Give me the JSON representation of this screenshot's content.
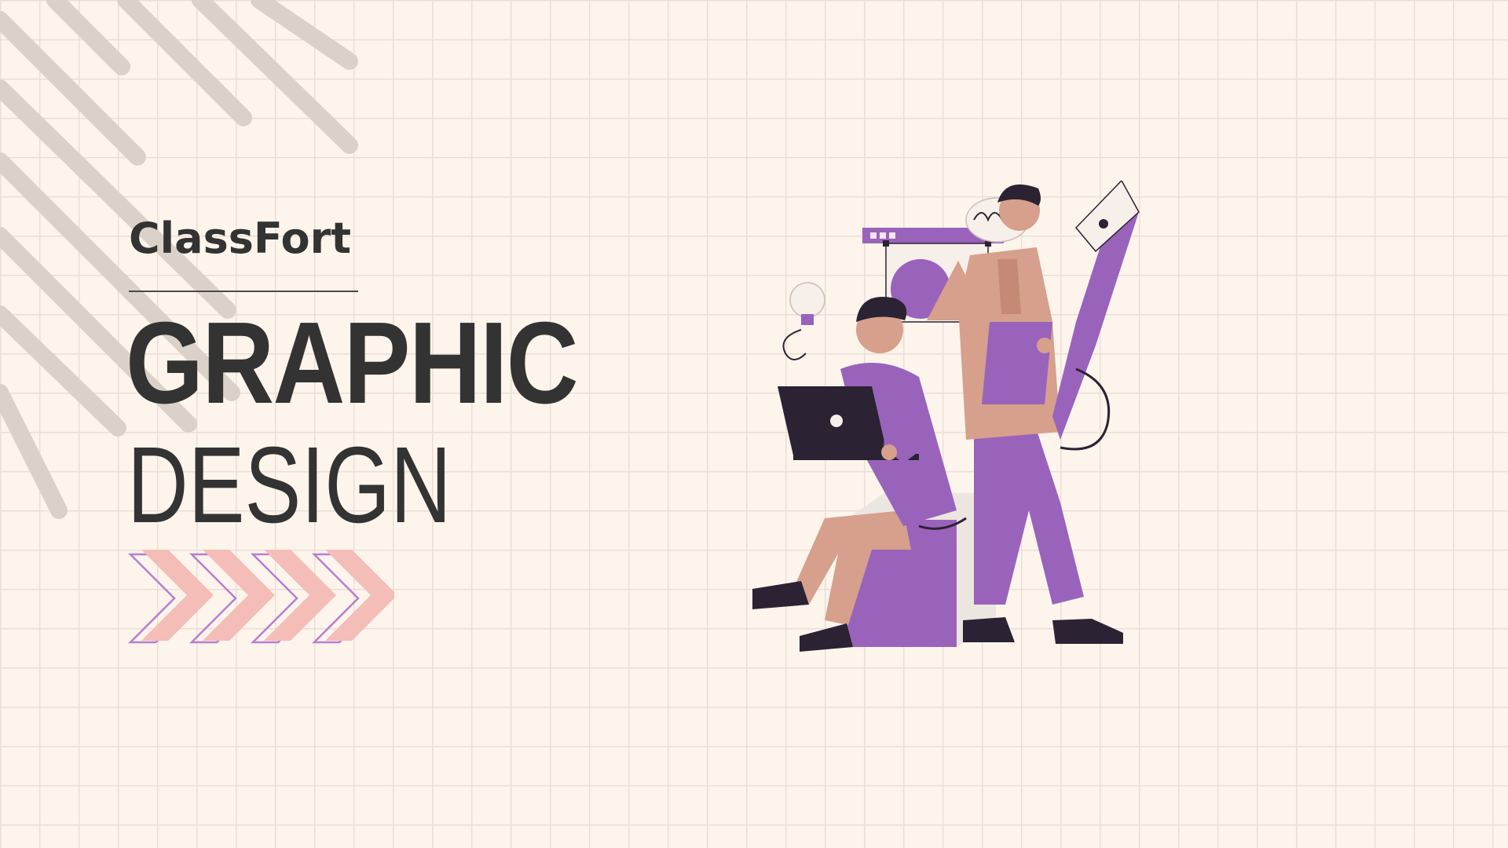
{
  "brand": {
    "name": "ClassFort"
  },
  "headline": {
    "line1": "GRAPHIC",
    "line2": "DESIGN"
  },
  "colors": {
    "background": "#fdf4ec",
    "grid": "#eadfd6",
    "text": "#333333",
    "stripes": "#dcd1c8",
    "chevron_fill": "#f4bdb7",
    "chevron_outline": "#b67fcf",
    "purple": "#9a63bb",
    "tan": "#d6a08c",
    "dark": "#2b2233"
  },
  "decorations": {
    "stripes_icon": "diagonal-stripes-decoration",
    "chevrons_icon": "chevron-arrows-decoration",
    "chevron_count": 4
  },
  "illustration": {
    "icon": "designers-illustration"
  }
}
